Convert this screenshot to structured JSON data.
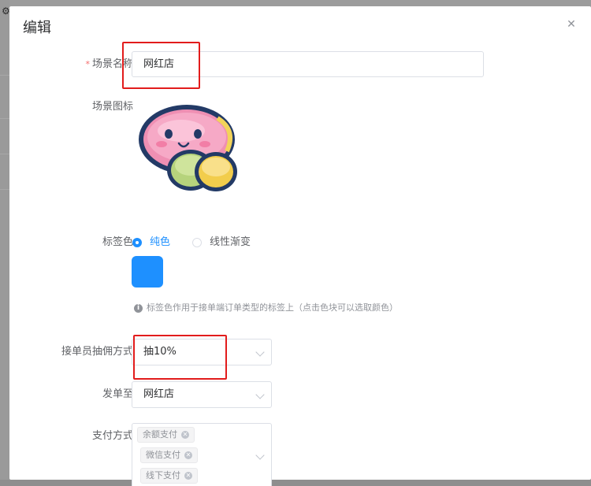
{
  "dialog": {
    "title": "编辑"
  },
  "form": {
    "scene_name": {
      "label": "场景名称",
      "required_mark": "*",
      "value": "网红店"
    },
    "scene_icon": {
      "label": "场景图标"
    },
    "tag_color": {
      "label": "标签色",
      "options": [
        "纯色",
        "线性渐变"
      ],
      "selected": "纯色",
      "swatch_color": "#1e90ff",
      "hint": "标签色作用于接单端订单类型的标签上（点击色块可以选取颜色）"
    },
    "commission": {
      "label": "接单员抽佣方式",
      "value": "抽10%"
    },
    "send_to": {
      "label": "发单至",
      "value": "网红店"
    },
    "payment": {
      "label": "支付方式",
      "tags": [
        "余额支付",
        "微信支付",
        "线下支付"
      ]
    }
  },
  "icons": {
    "close": "close-icon",
    "info": "info-icon",
    "chevron": "chevron-down-icon",
    "settings": "gear-icon"
  },
  "colors": {
    "primary": "#1e90ff",
    "annotation": "#e21c1c"
  }
}
